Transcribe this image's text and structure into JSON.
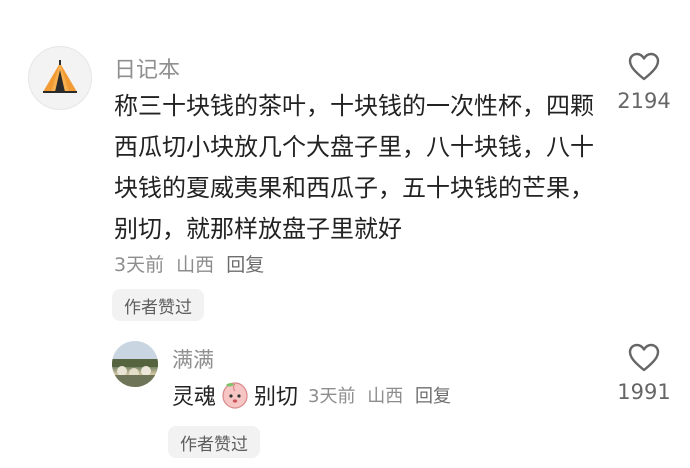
{
  "comment": {
    "author": "日记本",
    "avatar_icon": "tent-icon",
    "text": "称三十块钱的茶叶，十块钱的一次性杯，四颗西瓜切小块放几个大盘子里，八十块钱，八十块钱的夏威夷果和西瓜子，五十块钱的芒果，别切，就那样放盘子里就好",
    "time": "3天前",
    "location": "山西",
    "reply_label": "回复",
    "badge": "作者赞过",
    "likes": "2194",
    "heart_icon": "heart-outline-icon"
  },
  "reply": {
    "author": "满满",
    "text_before": "灵魂",
    "emoji_icon": "peach-face-emoji-icon",
    "text_after": "别切",
    "time": "3天前",
    "location": "山西",
    "reply_label": "回复",
    "badge": "作者赞过",
    "likes": "1991",
    "heart_icon": "heart-outline-icon"
  },
  "colors": {
    "tent_orange": "#f29a34",
    "text_primary": "#222222",
    "text_secondary": "#8d8d8d",
    "badge_bg": "#f2f2f2"
  }
}
